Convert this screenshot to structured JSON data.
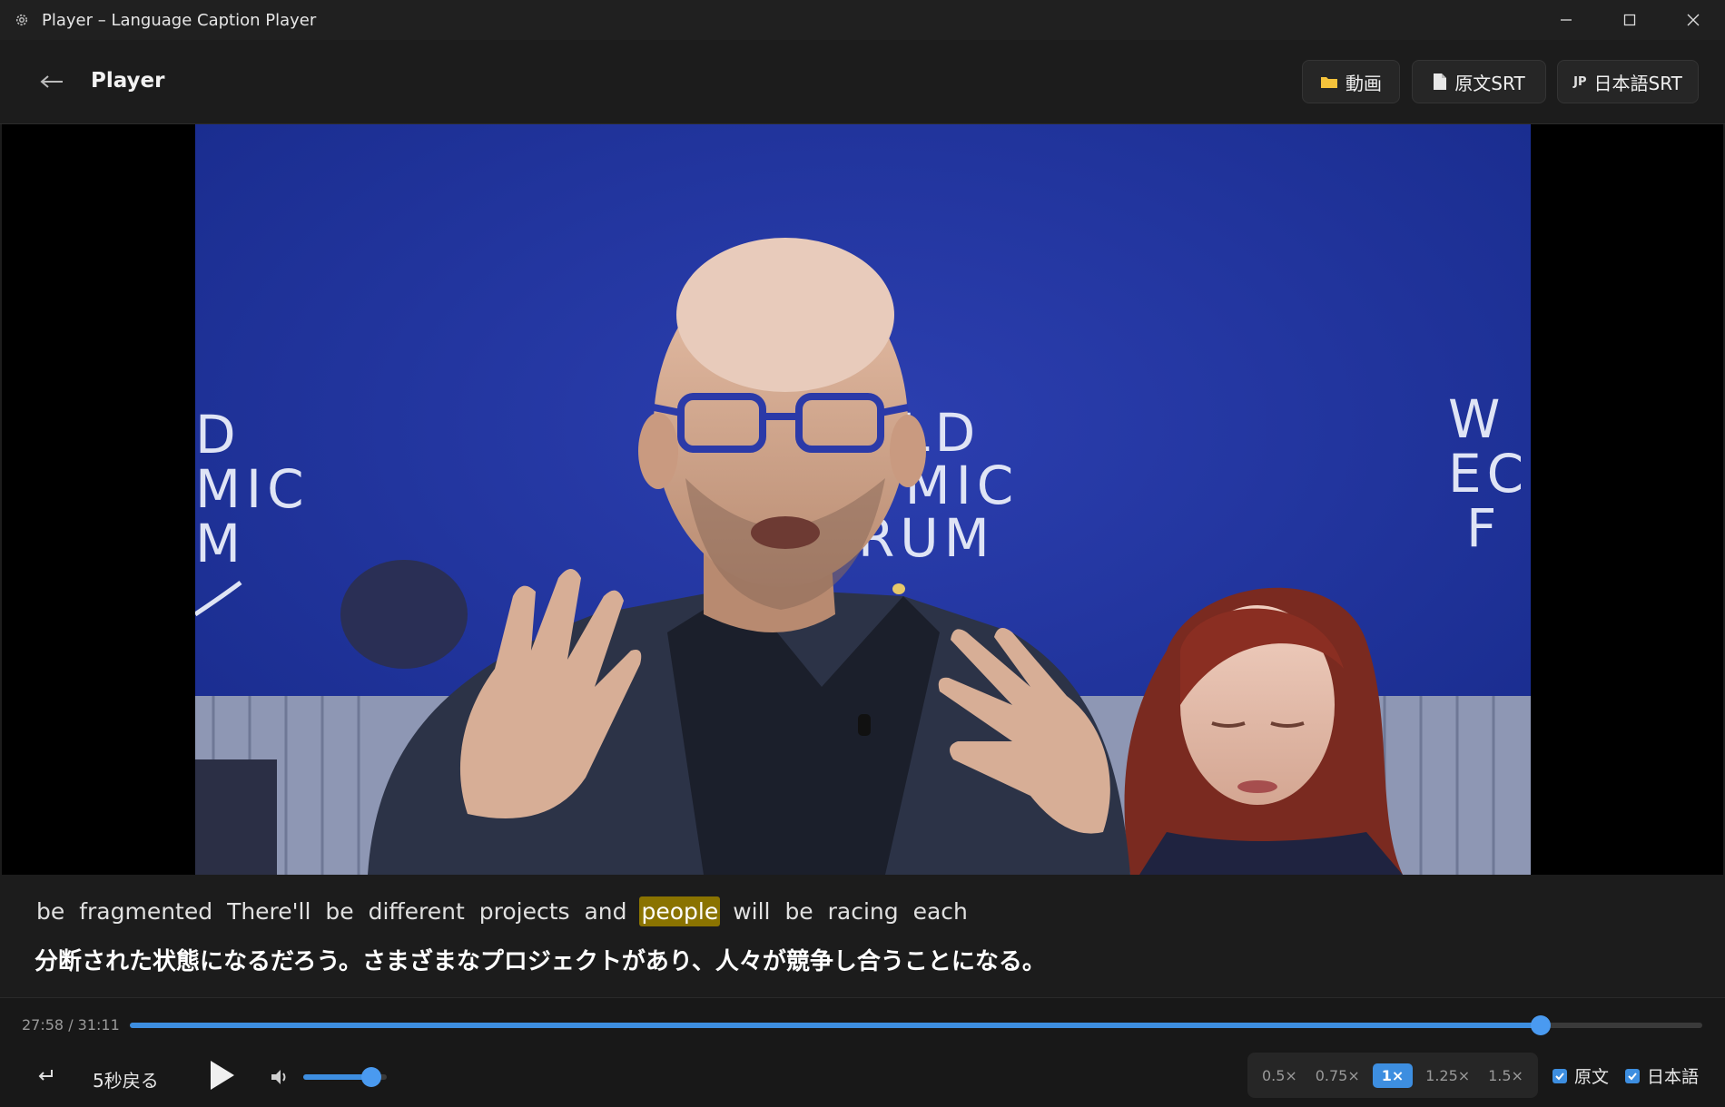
{
  "window": {
    "title": "Player – Language Caption Player"
  },
  "header": {
    "back_icon": "arrow-left-icon",
    "title": "Player",
    "buttons": [
      {
        "label": "動画",
        "icon": "folder-icon"
      },
      {
        "label": "原文SRT",
        "icon": "document-icon"
      },
      {
        "label": "日本語SRT",
        "icon": "jp-tag-icon",
        "tag": "JP"
      }
    ]
  },
  "video": {
    "backdrop_texts": {
      "left": [
        "D",
        "MIC",
        "M"
      ],
      "center": [
        "RLD",
        "OMIC",
        "RUM"
      ],
      "right": [
        "W",
        "ECO",
        "F"
      ]
    }
  },
  "subtitles": {
    "source_words": [
      "be",
      "fragmented",
      "There'll",
      "be",
      "different",
      "projects",
      "and",
      "people",
      "will",
      "be",
      "racing",
      "each"
    ],
    "highlighted_word": "people",
    "japanese": "分断された状態になるだろう。さまざまなプロジェクトがあり、人々が競争し合うことになる。"
  },
  "controls": {
    "time_display": "27:58 / 31:11",
    "progress": 0.8972,
    "rewind_label": "5秒戻る",
    "volume": 0.82,
    "speeds": [
      "0.5×",
      "0.75×",
      "1×",
      "1.25×",
      "1.5×"
    ],
    "active_speed": "1×",
    "toggles": [
      {
        "label": "原文",
        "checked": true
      },
      {
        "label": "日本語",
        "checked": true
      }
    ]
  },
  "colors": {
    "accent": "#3d8ee0",
    "highlight": "#8a7300",
    "background": "#1c1c1c"
  }
}
